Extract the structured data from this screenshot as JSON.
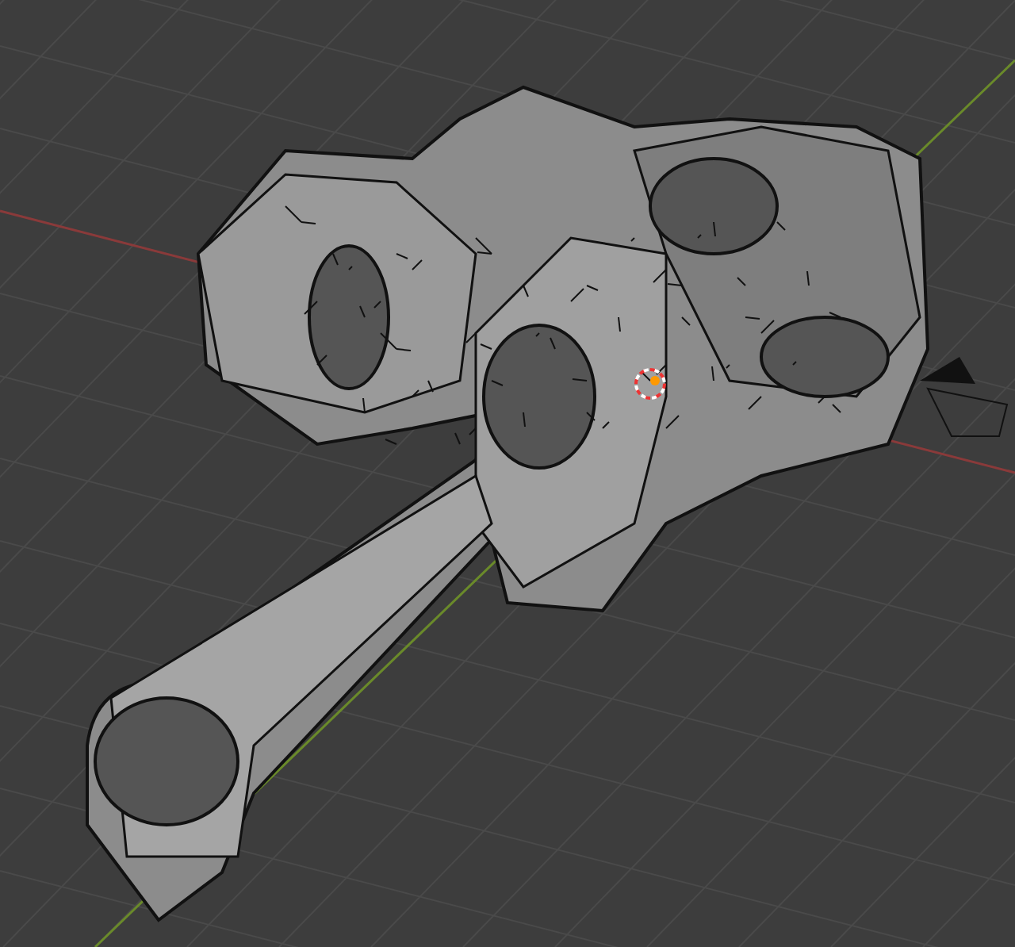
{
  "viewport": {
    "show_grid": true,
    "show_axes": true,
    "show_3d_cursor": true,
    "show_camera": true
  }
}
